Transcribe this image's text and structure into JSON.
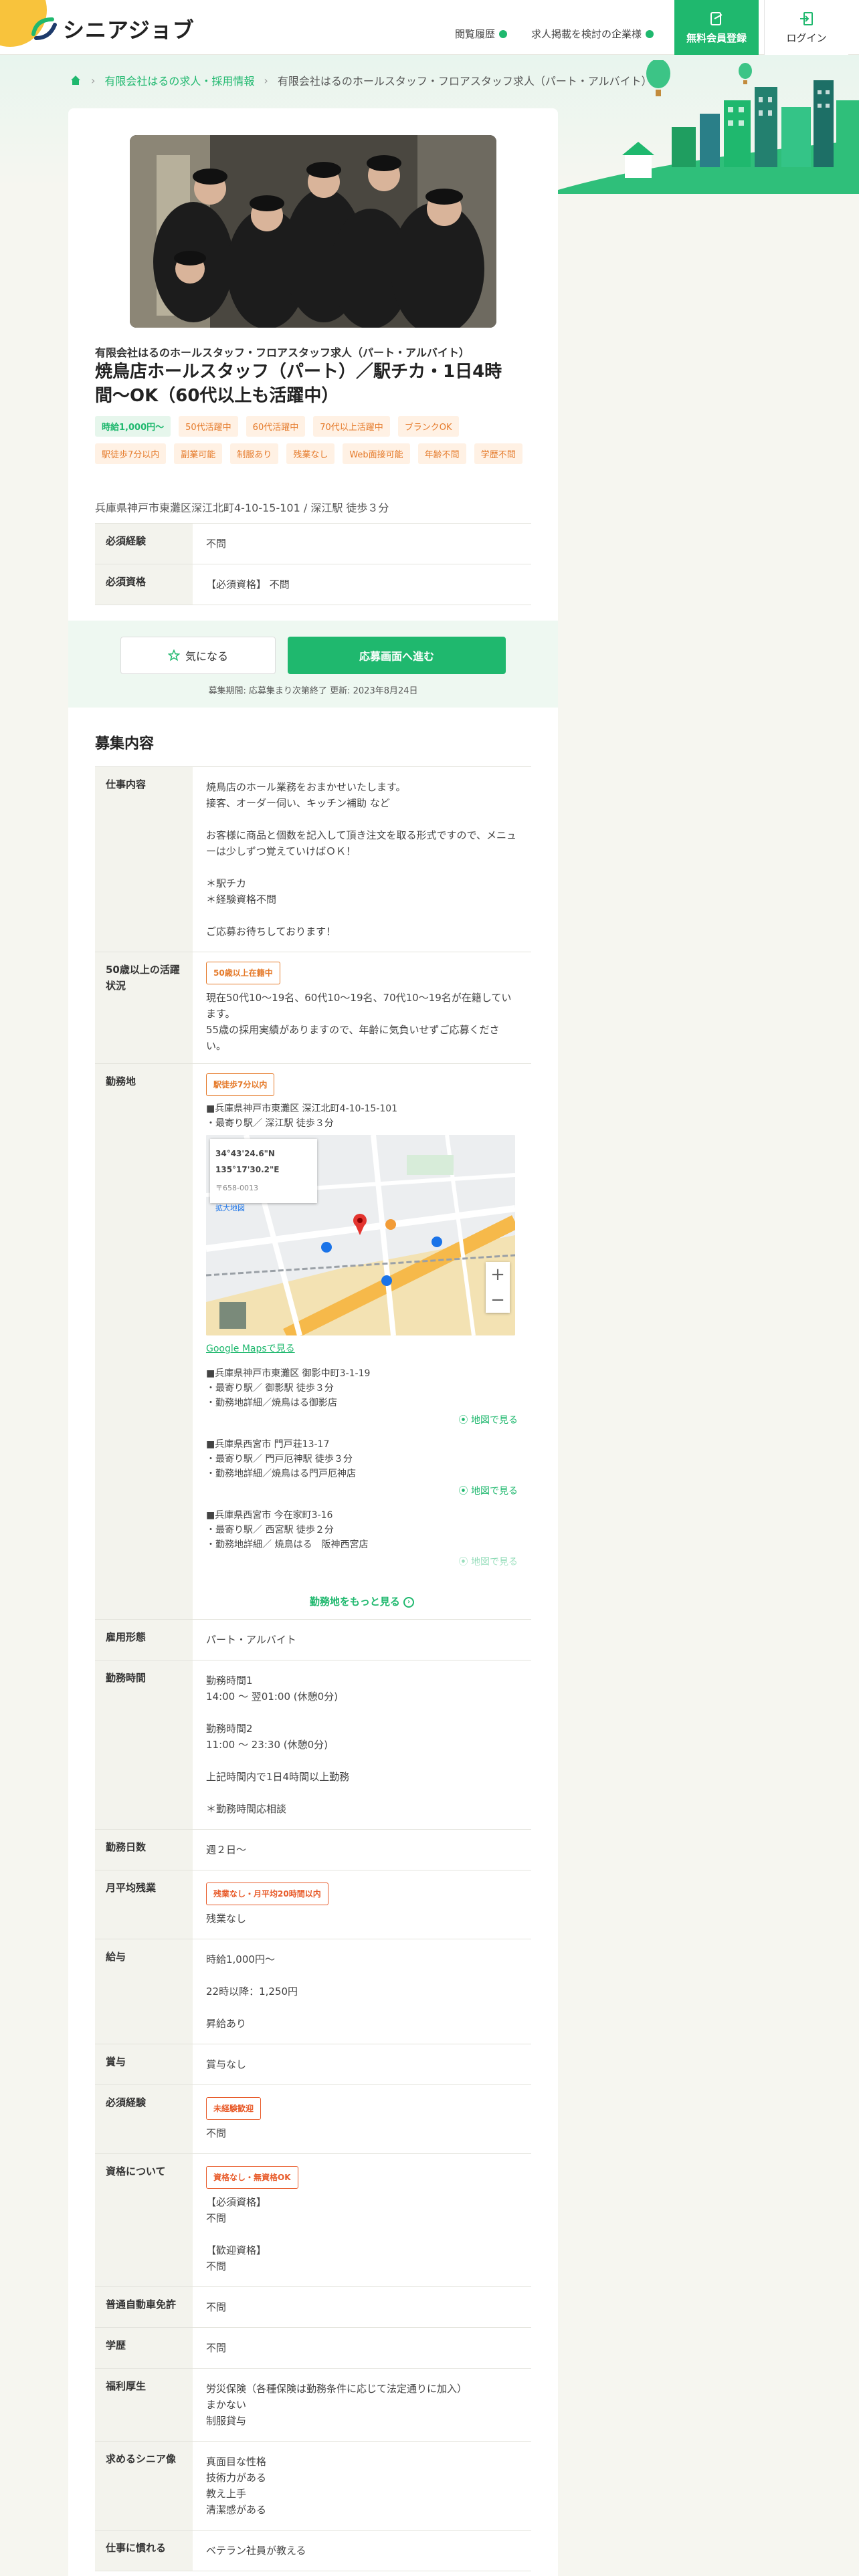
{
  "header": {
    "logo_text": "シニアジョブ",
    "links": [
      "閲覧履歴",
      "求人掲載を検討の企業様"
    ],
    "register_label": "無料会員登録",
    "login_label": "ログイン"
  },
  "breadcrumb": {
    "items": [
      "有限会社はるの求人・採用情報",
      "有限会社はるのホールスタッフ・フロアスタッフ求人（パート・アルバイト）"
    ]
  },
  "job": {
    "company_line": "有限会社はるのホールスタッフ・フロアスタッフ求人（パート・アルバイト）",
    "title": "焼鳥店ホールスタッフ（パート）／駅チカ・1日4時間〜OK（60代以上も活躍中）",
    "tags_green": [
      "時給1,000円〜"
    ],
    "tags": [
      "50代活躍中",
      "60代活躍中",
      "70代以上活躍中",
      "ブランクOK",
      "駅徒歩7分以内",
      "副業可能",
      "制服あり",
      "残業なし",
      "Web面接可能",
      "年齢不問",
      "学歴不問"
    ],
    "address": "兵庫県神戸市東灘区深江北町4-10-15-101 / 深江駅 徒歩３分",
    "summary": [
      {
        "th": "必須経験",
        "td": "不問"
      },
      {
        "th": "必須資格",
        "td": "【必須資格】 不問"
      }
    ]
  },
  "apply": {
    "fav_label": "気になる",
    "apply_label": "応募画面へ進む",
    "meta": "募集期間: 応募集まり次第終了   更新: 2023年8月24日"
  },
  "details": {
    "section_title": "募集内容",
    "job_content_th": "仕事内容",
    "job_content": "焼鳥店のホール業務をおまかせいたします。\n接客、オーダー伺い、キッチン補助 など\n\nお客様に商品と個数を記入して頂き注文を取る形式ですので、メニューは少しずつ覚えていけばＯＫ！\n\n＊駅チカ\n＊経験資格不問\n\nご応募お待ちしております！",
    "senior_th": "50歳以上の活躍状況",
    "senior_badge": "50歳以上在籍中",
    "senior_text": "現在50代10〜19名、60代10〜19名、70代10〜19名が在籍しています。\n55歳の採用実績がありますので、年齢に気負いせずご応募ください。",
    "location_th": "勤務地",
    "location_badge": "駅徒歩7分以内",
    "location_main": "■兵庫県神戸市東灘区 深江北町4-10-15-101\n・最寄り駅／ 深江駅 徒歩３分",
    "map": {
      "coords": "34°43'24.6\"N 135°17'30.2\"E",
      "addr": "〒658-0013",
      "link": "拡大地図",
      "gmaps": "Google Mapsで見る"
    },
    "locations": [
      {
        "text": "■兵庫県神戸市東灘区 御影中町3-1-19\n・最寄り駅／ 御影駅 徒歩３分\n・勤務地詳細／焼鳥はる御影店",
        "link": "地図で見る"
      },
      {
        "text": "■兵庫県西宮市 門戸荘13-17\n・最寄り駅／ 門戸厄神駅 徒歩３分\n・勤務地詳細／焼鳥はる門戸厄神店",
        "link": "地図で見る"
      },
      {
        "text": "■兵庫県西宮市 今在家町3-16\n・最寄り駅／ 西宮駅 徒歩２分\n・勤務地詳細／ 焼鳥はる　阪神西宮店",
        "link": "地図で見る"
      }
    ],
    "more_locations": "勤務地をもっと見る",
    "rows": [
      {
        "th": "雇用形態",
        "td": "パート・アルバイト"
      },
      {
        "th": "勤務時間",
        "td": "勤務時間1\n14:00 〜 翌01:00 (休憩0分)\n\n勤務時間2\n11:00 〜 23:30 (休憩0分)\n\n上記時間内で1日4時間以上勤務\n\n＊勤務時間応相談"
      },
      {
        "th": "勤務日数",
        "td": "週２日〜"
      },
      {
        "th": "月平均残業",
        "badge": "残業なし・月平均20時間以内",
        "td": "残業なし"
      },
      {
        "th": "給与",
        "td": "時給1,000円〜\n\n22時以降：1,250円\n\n昇給あり"
      },
      {
        "th": "賞与",
        "td": "賞与なし"
      },
      {
        "th": "必須経験",
        "badge": "未経験歓迎",
        "td": "不問"
      },
      {
        "th": "資格について",
        "badge": "資格なし・無資格OK",
        "td": "【必須資格】\n不問\n\n【歓迎資格】\n不問"
      },
      {
        "th": "普通自動車免許",
        "td": "不問"
      },
      {
        "th": "学歴",
        "td": "不問"
      },
      {
        "th": "福利厚生",
        "td": "労災保険（各種保険は勤務条件に応じて法定通りに加入）\nまかない\n制服貸与"
      },
      {
        "th": "求めるシニア像",
        "td": "真面目な性格\n技術力がある\n教え上手\n清潔感がある"
      },
      {
        "th": "仕事に慣れる",
        "td": "ベテラン社員が教える"
      }
    ]
  }
}
